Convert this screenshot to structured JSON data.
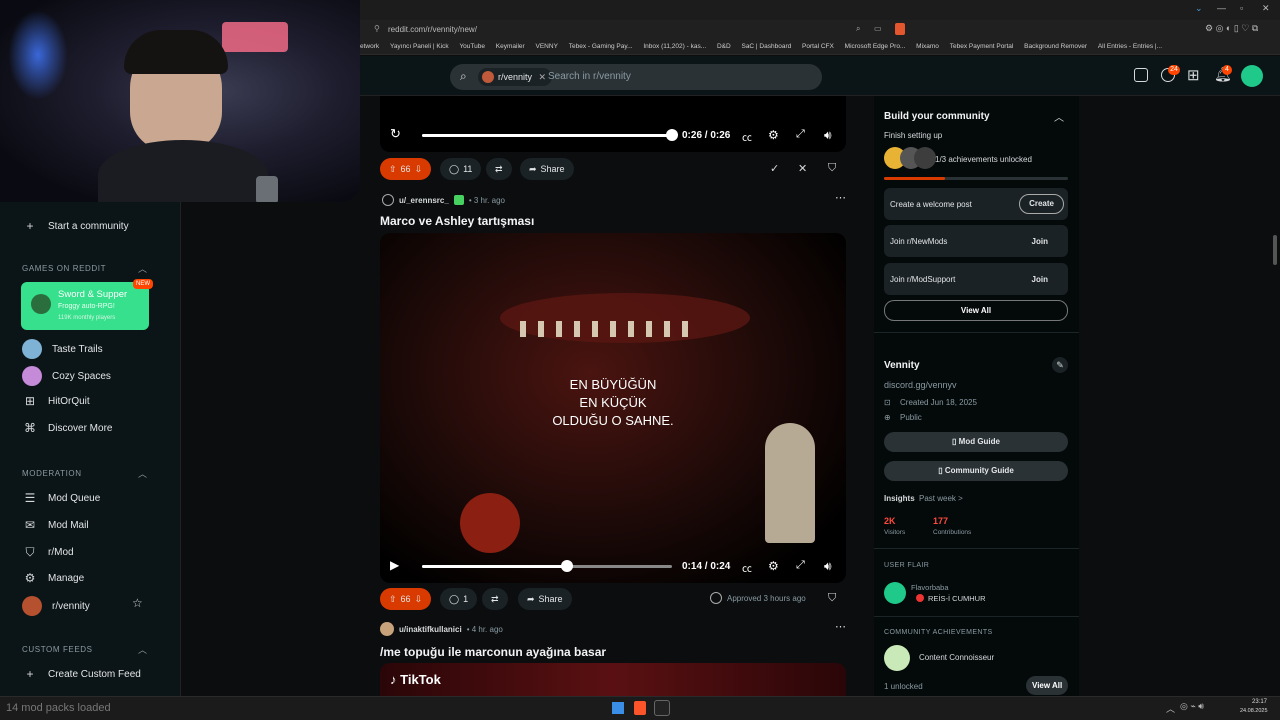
{
  "browser": {
    "url": "reddit.com/r/vennity/new/",
    "bookmarks": [
      "etwork",
      "Yayıncı Paneli | Kick",
      "YouTube",
      "Keymailer",
      "VENNY",
      "Tebex - Gaming Pay...",
      "Inbox (11,202) - kas...",
      "D&D",
      "SaC | Dashboard",
      "Portal CFX",
      "Microsoft Edge Pro...",
      "Mixamo",
      "Tebex Payment Portal",
      "Background Remover",
      "All Entries - Entries |..."
    ]
  },
  "header": {
    "search_chip": "r/vennity",
    "search_placeholder": "Search in r/vennity",
    "chat_badge": "24",
    "notif_badge": "4"
  },
  "sidebar": {
    "start_community": "Start a community",
    "games_header": "GAMES ON REDDIT",
    "featured_game": {
      "name": "Sword & Supper",
      "desc": "Froggy auto-RPG!",
      "players": "119K monthly players",
      "badge": "NEW"
    },
    "games": [
      "Taste Trails",
      "Cozy Spaces",
      "HitOrQuit",
      "Discover More"
    ],
    "moderation_header": "MODERATION",
    "moderation": [
      "Mod Queue",
      "Mod Mail",
      "r/Mod",
      "Manage",
      "r/vennity"
    ],
    "custom_header": "CUSTOM FEEDS",
    "create_feed": "Create Custom Feed"
  },
  "post1": {
    "time": "0:26 / 0:26",
    "progress": 1.0,
    "votes": "66",
    "comments": "11",
    "share": "Share"
  },
  "post2": {
    "author": "u/_erennsrc_",
    "age": "• 3 hr. ago",
    "title": "Marco ve Ashley tartışması",
    "caption_1": "EN BÜYÜĞÜN",
    "caption_2": "EN KÜÇÜK",
    "caption_3": "OLDUĞU O SAHNE.",
    "time": "0:14 / 0:24",
    "progress": 0.58,
    "votes": "66",
    "comments": "1",
    "share": "Share",
    "approved": "Approved 3 hours ago"
  },
  "post3": {
    "author": "u/inaktifkullanici",
    "age": "• 4 hr. ago",
    "title": "/me topuğu ile marconun ayağına basar",
    "tiktok": "TikTok"
  },
  "right": {
    "build_title": "Build your community",
    "finish": "Finish setting up",
    "achievements": "1/3 achievements unlocked",
    "welcome_post": "Create a welcome post",
    "create": "Create",
    "join_newmods": "Join r/NewMods",
    "join_modsupport": "Join r/ModSupport",
    "join": "Join",
    "view_all": "View All",
    "community_name": "Vennity",
    "discord": "discord.gg/vennyv",
    "created": "Created Jun 18, 2025",
    "public": "Public",
    "mod_guide": "Mod Guide",
    "community_guide": "Community Guide",
    "insights": "Insights",
    "past_week": "Past week >",
    "visitors_val": "2K",
    "visitors": "Visitors",
    "contrib_val": "177",
    "contributions": "Contributions",
    "flair_header": "USER FLAIR",
    "flair_user": "Flavorbaba",
    "flair_tag": "REİS-İ CUMHUR",
    "ach_header": "COMMUNITY ACHIEVEMENTS",
    "ach_name": "Content Connoisseur",
    "ach_unlocked": "1 unlocked",
    "ach_view_all": "View All"
  },
  "taskbar": {
    "status": "14 mod packs loaded",
    "time": "23:17",
    "date": "24.08.2025"
  }
}
